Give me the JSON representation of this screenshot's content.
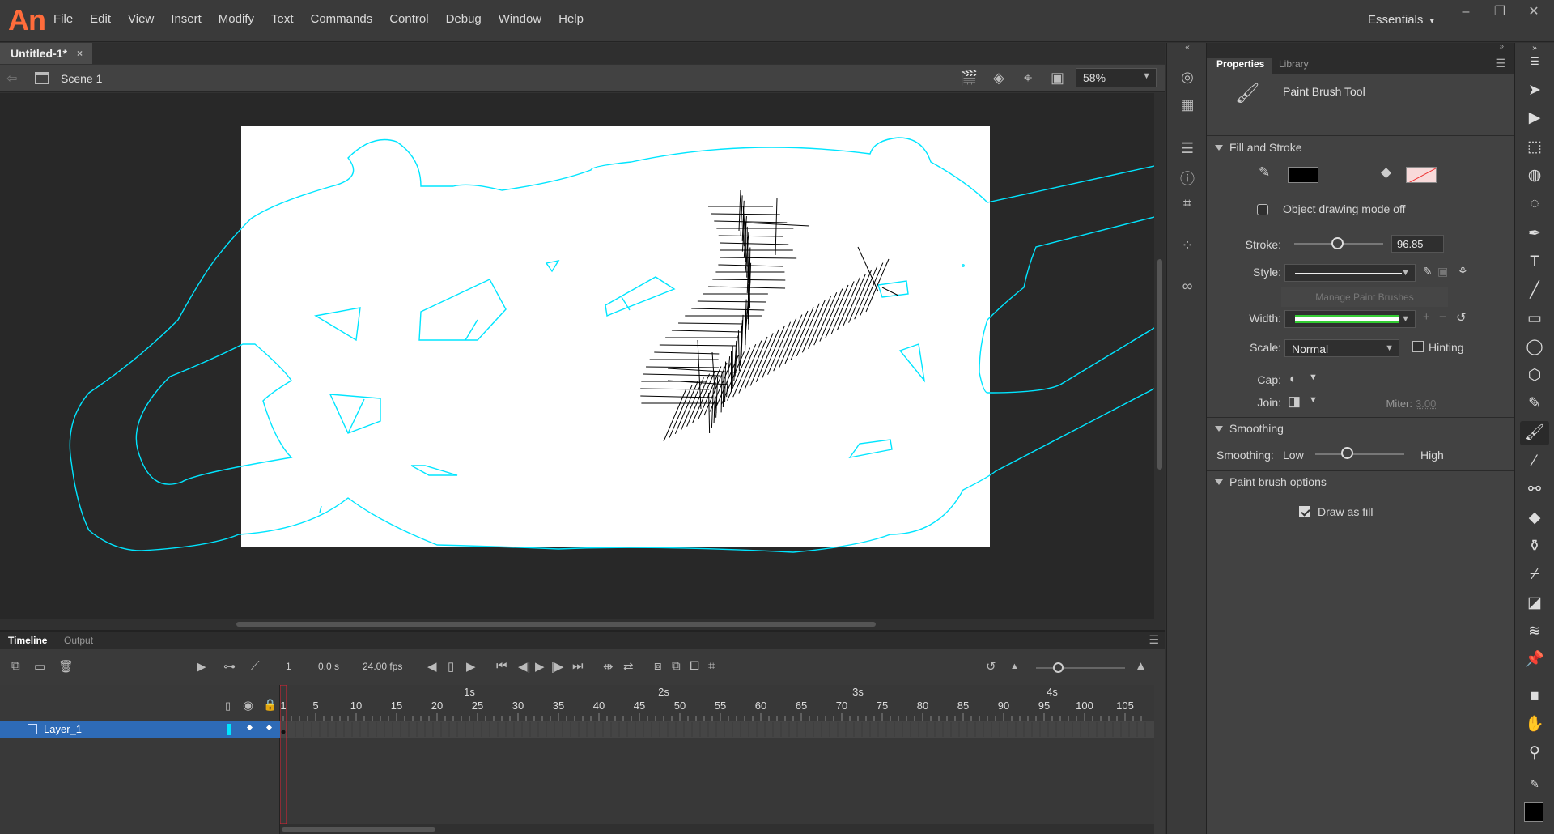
{
  "app": {
    "logo": "An"
  },
  "menus": [
    "File",
    "Edit",
    "View",
    "Insert",
    "Modify",
    "Text",
    "Commands",
    "Control",
    "Debug",
    "Window",
    "Help"
  ],
  "workspace": {
    "label": "Essentials",
    "arrow": "▾"
  },
  "window_controls": {
    "minimize": "–",
    "restore": "❐",
    "close": "✕"
  },
  "document": {
    "tab": "Untitled-1*",
    "close": "×"
  },
  "scene": {
    "label": "Scene 1",
    "zoom": "58%"
  },
  "timeline": {
    "tabs": {
      "timeline": "Timeline",
      "output": "Output"
    },
    "current_frame": "1",
    "time": "0.0 s",
    "fps": "24.00 fps",
    "layer_name": "Layer_1",
    "second_labels": [
      "1s",
      "2s",
      "3s",
      "4s"
    ],
    "frame_numbers": [
      "1",
      "5",
      "10",
      "15",
      "20",
      "25",
      "30",
      "35",
      "40",
      "45",
      "50",
      "55",
      "60",
      "65",
      "70",
      "75",
      "80",
      "85",
      "90",
      "95",
      "100",
      "105"
    ]
  },
  "properties": {
    "tabs": {
      "properties": "Properties",
      "library": "Library"
    },
    "tool_name": "Paint Brush Tool",
    "fill_stroke": {
      "header": "Fill and Stroke",
      "stroke_color": "#000000",
      "object_drawing": "Object drawing mode off",
      "stroke_label": "Stroke:",
      "stroke_value": "96.85",
      "stroke_slider_fraction": 0.48,
      "style_label": "Style:",
      "manage_brushes": "Manage Paint Brushes",
      "width_label": "Width:",
      "scale_label": "Scale:",
      "scale_value": "Normal",
      "hinting": "Hinting",
      "cap_label": "Cap:",
      "join_label": "Join:",
      "miter_label": "Miter:",
      "miter_value": "3.00"
    },
    "smoothing": {
      "header": "Smoothing",
      "label": "Smoothing:",
      "low": "Low",
      "high": "High",
      "slider_fraction": 0.35
    },
    "brush_options": {
      "header": "Paint brush options",
      "draw_as_fill": "Draw as fill",
      "draw_as_fill_checked": true
    }
  },
  "colors": {
    "accent": "#2e6bb7",
    "outline": "#00e5ff",
    "stage": "#ffffff",
    "pasteboard": "#282828",
    "logo": "#ff6c3b"
  }
}
